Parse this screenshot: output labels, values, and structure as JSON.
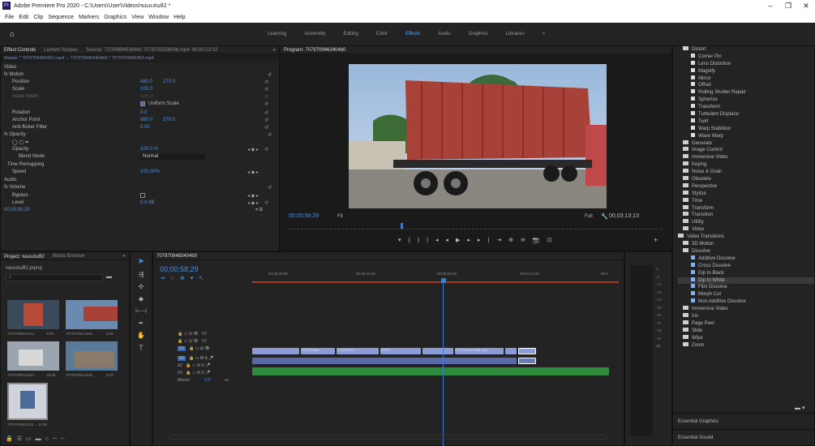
{
  "window": {
    "title": "Adobe Premiere Pro 2020 - C:\\Users\\User\\Videos\\ของเล่นหิ2 *",
    "min": "–",
    "restore": "❐",
    "close": "✕"
  },
  "menu": [
    "File",
    "Edit",
    "Clip",
    "Sequence",
    "Markers",
    "Graphics",
    "View",
    "Window",
    "Help"
  ],
  "workspace": {
    "tabs": [
      "Learning",
      "Assembly",
      "Editing",
      "Color",
      "Effects",
      "Audio",
      "Graphics",
      "Libraries"
    ],
    "active": "Effects",
    "more": "»"
  },
  "effect_controls": {
    "tabs": [
      "Effect Controls",
      "Lumetri Scopes",
      "Source: 707908945394b0 707970525600b.mp4: 00;00;22;02"
    ],
    "expand": "»",
    "master": "Master * 7079709460452.mp4 ⌄ 7079709463404b0 * 7079709460452.mp4",
    "section_video": "Video",
    "rows": [
      {
        "label": "fx Motion"
      },
      {
        "label": "Position",
        "v1": "480.0",
        "v2": "270.0"
      },
      {
        "label": "Scale",
        "v1": "100.0"
      },
      {
        "label": "Scale Width",
        "v1": "100.0"
      },
      {
        "label": "Uniform Scale"
      },
      {
        "label": "Rotation",
        "v1": "0.0"
      },
      {
        "label": "Anchor Point",
        "v1": "960.0",
        "v2": "270.0"
      },
      {
        "label": "Anti-flicker Filter",
        "v1": "0.00"
      },
      {
        "label": "fx Opacity"
      },
      {
        "label": "Opacity",
        "v1": "100.0 %"
      },
      {
        "label": "Blend Mode",
        "v1": "Normal"
      },
      {
        "label": "Time Remapping"
      },
      {
        "label": "Speed",
        "v1": "100.00%"
      },
      {
        "label": "Audio"
      },
      {
        "label": "fx Volume"
      },
      {
        "label": "Bypass"
      },
      {
        "label": "Level",
        "v1": "0.0 dB"
      }
    ],
    "timecode": "00;00;58;29",
    "reset": "↺"
  },
  "program": {
    "title": "Program: 7079709463404b0",
    "timecode": "00;00;58;29",
    "fit": "Fit",
    "full": "Full",
    "duration": "00;03;13;13"
  },
  "project": {
    "tabs": [
      "Project: ของเล่นหิ2",
      "Media Browser"
    ],
    "expand": "»",
    "file": "ของเล่นหิ2.prproj",
    "search_placeholder": "",
    "items": [
      {
        "name": "7079709527441...",
        "dur": "3:08"
      },
      {
        "name": "7079709514408...",
        "dur": "5:06"
      },
      {
        "name": "7079709512391...",
        "dur": "16:08"
      },
      {
        "name": "7079709514408...",
        "dur": "8:04"
      },
      {
        "name": "7079709463112...",
        "dur": "11:08"
      }
    ]
  },
  "timeline": {
    "tab": "7079709463404b0",
    "timecode": "00;00;58;29",
    "ruler": [
      "00;00;29;29",
      "00;00;44;28",
      "00;00;59;28",
      "00;01;14;29",
      "00;0"
    ],
    "tracks": [
      "V3",
      "V2",
      "V1",
      "A1",
      "A2",
      "A3",
      "Master"
    ],
    "master_val": "0.0",
    "clips": [
      "7079709460...",
      "7079709461...",
      "70797...",
      "7079709462339B.mp4"
    ]
  },
  "effects": {
    "items": [
      {
        "t": "Distort",
        "k": "bin",
        "lvl": 0
      },
      {
        "t": "Corner Pin",
        "k": "fx",
        "lvl": 1
      },
      {
        "t": "Lens Distortion",
        "k": "fx",
        "lvl": 1
      },
      {
        "t": "Magnify",
        "k": "fx",
        "lvl": 1
      },
      {
        "t": "Mirror",
        "k": "fx",
        "lvl": 1
      },
      {
        "t": "Offset",
        "k": "fx",
        "lvl": 1
      },
      {
        "t": "Rolling Shutter Repair",
        "k": "fx",
        "lvl": 1
      },
      {
        "t": "Spherize",
        "k": "fx",
        "lvl": 1
      },
      {
        "t": "Transform",
        "k": "fx",
        "lvl": 1
      },
      {
        "t": "Turbulent Displace",
        "k": "fx",
        "lvl": 1
      },
      {
        "t": "Twirl",
        "k": "fx",
        "lvl": 1
      },
      {
        "t": "Warp Stabilizer",
        "k": "fx",
        "lvl": 1
      },
      {
        "t": "Wave Warp",
        "k": "fx",
        "lvl": 1
      },
      {
        "t": "Generate",
        "k": "bin",
        "lvl": 0
      },
      {
        "t": "Image Control",
        "k": "bin",
        "lvl": 0
      },
      {
        "t": "Immersive Video",
        "k": "bin",
        "lvl": 0
      },
      {
        "t": "Keying",
        "k": "bin",
        "lvl": 0
      },
      {
        "t": "Noise & Grain",
        "k": "bin",
        "lvl": 0
      },
      {
        "t": "Obsolete",
        "k": "bin",
        "lvl": 0
      },
      {
        "t": "Perspective",
        "k": "bin",
        "lvl": 0
      },
      {
        "t": "Stylize",
        "k": "bin",
        "lvl": 0
      },
      {
        "t": "Time",
        "k": "bin",
        "lvl": 0
      },
      {
        "t": "Transform",
        "k": "bin",
        "lvl": 0
      },
      {
        "t": "Transition",
        "k": "bin",
        "lvl": 0
      },
      {
        "t": "Utility",
        "k": "bin",
        "lvl": 0
      },
      {
        "t": "Video",
        "k": "bin",
        "lvl": 0
      },
      {
        "t": "Video Transitions",
        "k": "bin",
        "lvl": -1
      },
      {
        "t": "3D Motion",
        "k": "bin",
        "lvl": 0
      },
      {
        "t": "Dissolve",
        "k": "bin",
        "lvl": 0
      },
      {
        "t": "Additive Dissolve",
        "k": "tr",
        "lvl": 1
      },
      {
        "t": "Cross Dissolve",
        "k": "tr",
        "lvl": 1
      },
      {
        "t": "Dip to Black",
        "k": "tr",
        "lvl": 1
      },
      {
        "t": "Dip to White",
        "k": "tr",
        "lvl": 1,
        "sel": true
      },
      {
        "t": "Film Dissolve",
        "k": "tr",
        "lvl": 1
      },
      {
        "t": "Morph Cut",
        "k": "tr",
        "lvl": 1
      },
      {
        "t": "Non-Additive Dissolve",
        "k": "tr",
        "lvl": 1
      },
      {
        "t": "Immersive Video",
        "k": "bin",
        "lvl": 0
      },
      {
        "t": "Iris",
        "k": "bin",
        "lvl": 0
      },
      {
        "t": "Page Peel",
        "k": "bin",
        "lvl": 0
      },
      {
        "t": "Slide",
        "k": "bin",
        "lvl": 0
      },
      {
        "t": "Wipe",
        "k": "bin",
        "lvl": 0
      },
      {
        "t": "Zoom",
        "k": "bin",
        "lvl": 0
      }
    ],
    "essential_graphics": "Essential Graphics",
    "essential_sound": "Essential Sound"
  },
  "colors": {
    "accent": "#4a90e2",
    "playhead": "#3a7bd5",
    "video_clip": "#8a9bd6",
    "audio_clip": "#2e8b3e"
  }
}
